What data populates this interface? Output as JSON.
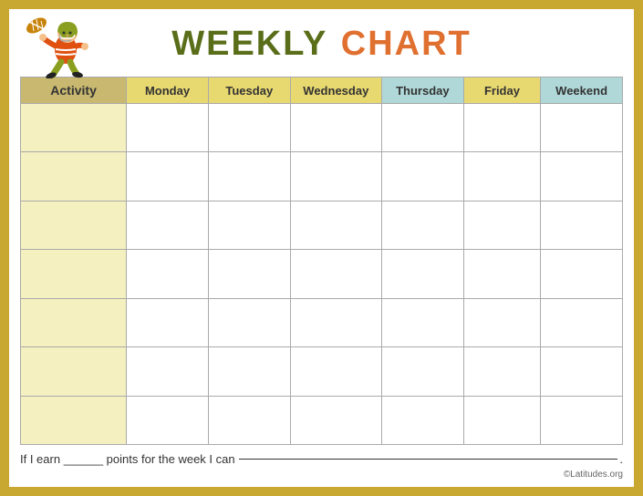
{
  "title": {
    "weekly": "WEEKLY",
    "chart": "CHART"
  },
  "headers": {
    "activity": "Activity",
    "days": [
      "Monday",
      "Tuesday",
      "Wednesday",
      "Thursday",
      "Friday",
      "Weekend"
    ]
  },
  "rows": [
    [
      "",
      "",
      "",
      "",
      "",
      ""
    ],
    [
      "",
      "",
      "",
      "",
      "",
      ""
    ],
    [
      "",
      "",
      "",
      "",
      "",
      ""
    ],
    [
      "",
      "",
      "",
      "",
      "",
      ""
    ],
    [
      "",
      "",
      "",
      "",
      "",
      ""
    ],
    [
      "",
      "",
      "",
      "",
      "",
      ""
    ],
    [
      "",
      "",
      "",
      "",
      "",
      ""
    ]
  ],
  "footer": {
    "text1": "If I earn ______ points for the week I can",
    "copyright": "©Latitudes.org"
  }
}
